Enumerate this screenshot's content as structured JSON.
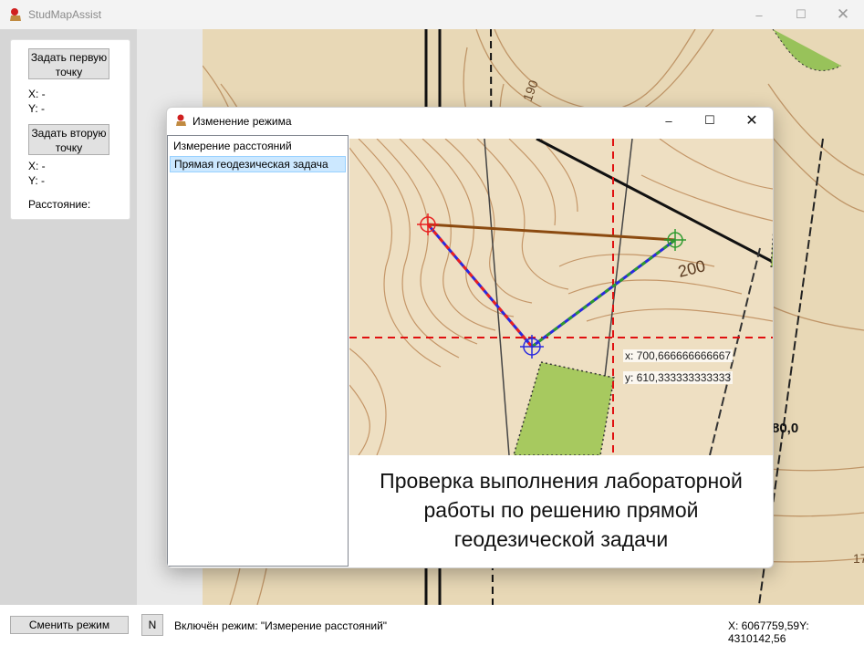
{
  "window": {
    "title": "StudMapAssist"
  },
  "controls": {
    "first_point_button": "Задать первую точку",
    "first_x": "X: -",
    "first_y": "Y: -",
    "second_point_button": "Задать вторую точку",
    "second_x": "X: -",
    "second_y": "Y: -",
    "distance_label": "Расстояние:"
  },
  "map": {
    "contour_labels": [
      "190",
      "80,0",
      "17"
    ]
  },
  "status": {
    "change_mode_button": "Сменить режим",
    "n_button": "N",
    "mode_text": "Включён режим: \"Измерение расстояний\"",
    "coordinates": "X: 6067759,59Y: 4310142,56"
  },
  "dialog": {
    "title": "Изменение режима",
    "modes": [
      "Измерение расстояний",
      "Прямая геодезическая задача"
    ],
    "selected_index": 1,
    "preview": {
      "contour_label": "200",
      "coord_x": "x: 700,666666666667",
      "coord_y": "y: 610,333333333333"
    },
    "caption": "Проверка выполнения лабораторной\nработы по решению прямой\nгеодезической задачи"
  },
  "colors": {
    "first_point": "#e82020",
    "second_point": "#2e9a2e",
    "third_point": "#2a2adf",
    "distance_line": "#8b4a10",
    "crosshair": "#e01010",
    "list_selection": "#cce8ff"
  }
}
